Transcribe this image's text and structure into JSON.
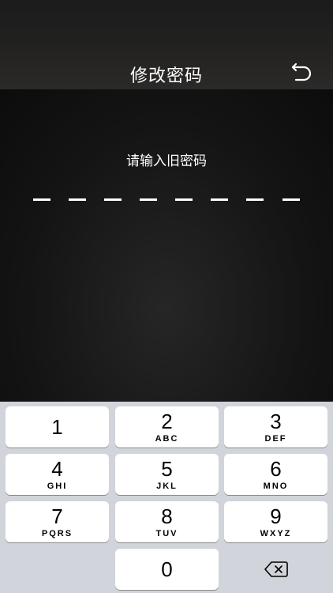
{
  "header": {
    "title": "修改密码",
    "back_icon": "undo-return-icon"
  },
  "content": {
    "prompt": "请输入旧密码",
    "pin_length": 8
  },
  "keypad": {
    "keys": [
      {
        "num": "1",
        "letters": ""
      },
      {
        "num": "2",
        "letters": "ABC"
      },
      {
        "num": "3",
        "letters": "DEF"
      },
      {
        "num": "4",
        "letters": "GHI"
      },
      {
        "num": "5",
        "letters": "JKL"
      },
      {
        "num": "6",
        "letters": "MNO"
      },
      {
        "num": "7",
        "letters": "PQRS"
      },
      {
        "num": "8",
        "letters": "TUV"
      },
      {
        "num": "9",
        "letters": "WXYZ"
      },
      {
        "num": "0",
        "letters": ""
      }
    ],
    "delete_icon": "backspace-icon"
  },
  "colors": {
    "keypad_bg": "#d1d4da",
    "key_bg": "#ffffff",
    "screen_bg": "#0f0f0f"
  }
}
